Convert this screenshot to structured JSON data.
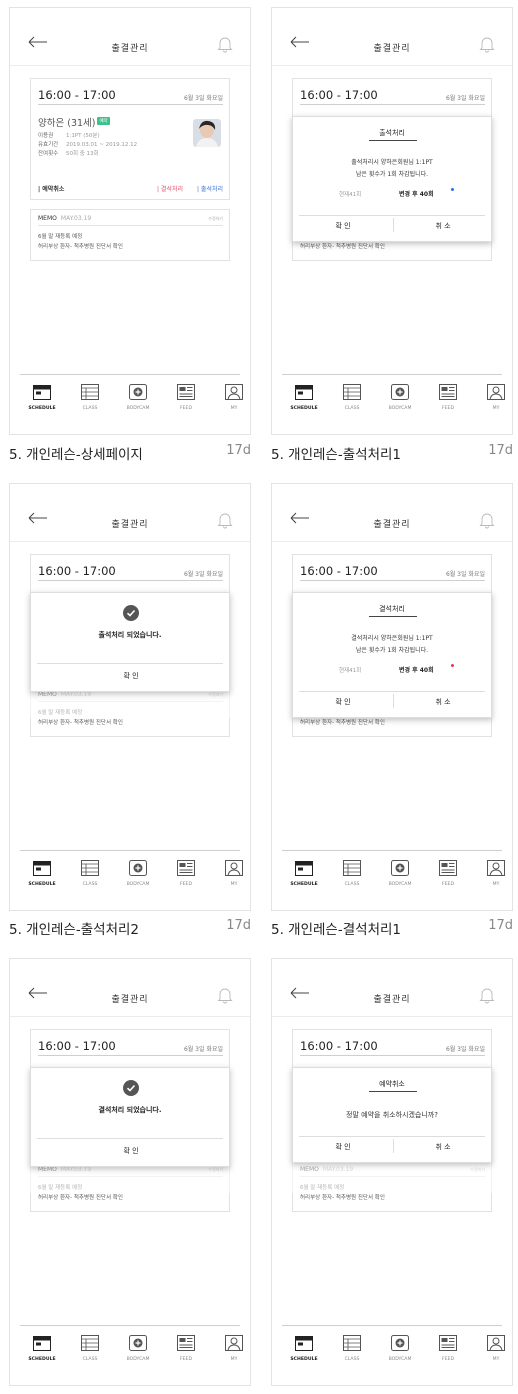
{
  "screen": {
    "title": "출결관리",
    "time": "16:00 - 17:00",
    "date": "6월 3일 화요일"
  },
  "member": {
    "name": "양하은 (31세)",
    "badge": "예약",
    "rows": [
      {
        "label": "이용권",
        "value": "1:1PT (50분)"
      },
      {
        "label": "유효기간",
        "value": "2019.03.01 ~ 2019.12.12"
      },
      {
        "label": "잔여횟수",
        "value": "50회 중 13회"
      }
    ]
  },
  "actions": {
    "cancel": "| 예약취소",
    "absent": "| 결석처리",
    "attend": "| 출석처리"
  },
  "memo": {
    "label": "MEMO",
    "date": "MAY.03.19",
    "edit": "수정하기",
    "lines": [
      "6월 말 재등록 예정",
      "허리부상 환자- 척추병원 진단서 확인"
    ]
  },
  "tabs": [
    {
      "label": "SCHEDULE"
    },
    {
      "label": "CLASS"
    },
    {
      "label": "BODYCAM"
    },
    {
      "label": "FEED"
    },
    {
      "label": "MY"
    }
  ],
  "dialogs": {
    "attend_title": "출석처리",
    "attend_line1": "출석처리시 양하은회원님 1:1PT",
    "line2": "남은 횟수가 1회 차감됩니다.",
    "before": "현재41회",
    "after": "변경 후 40회",
    "absent_title": "결석처리",
    "absent_line1": "결석처리시 양하은회원님 1:1PT",
    "attend_done": "출석처리 되었습니다.",
    "absent_done": "결석처리 되었습니다.",
    "cancel_title": "예약취소",
    "cancel_question": "정말 예약을 취소하시겠습니까?",
    "confirm": "확 인",
    "cancel": "취 소"
  },
  "captions": [
    {
      "title": "5. 개인레슨-상세페이지",
      "age": "17d"
    },
    {
      "title": "5. 개인레슨-출석처리1",
      "age": "17d"
    },
    {
      "title": "5. 개인레슨-출석처리2",
      "age": "17d"
    },
    {
      "title": "5. 개인레슨-결석처리1",
      "age": "17d"
    }
  ],
  "colors": {
    "attend_dot": "#2f6fe0",
    "absent_dot": "#e23b5a",
    "badge": "#3fbf8a"
  }
}
